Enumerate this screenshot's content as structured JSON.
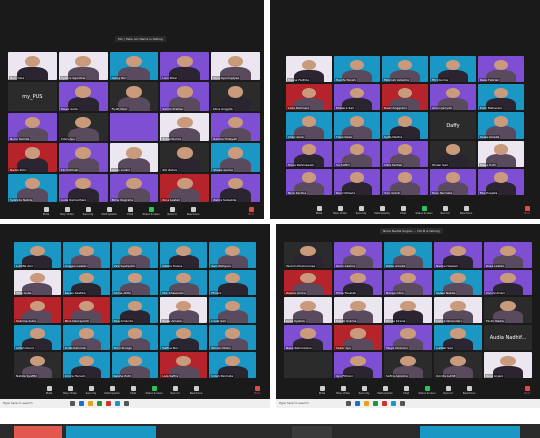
{
  "palette": {
    "panel_bg": "#1a1a1a",
    "tile_purple": "#7f4fd3",
    "tile_cyan": "#1b97c6",
    "tile_red": "#b7232a",
    "tile_dark": "#2b2b2b",
    "tile_white": "#ebe6ef",
    "skin": "#c99a7b",
    "hijab_dark": "#2b2431",
    "end_color": "#e04a4a",
    "share_color": "#2ac45a"
  },
  "toolbar": {
    "mute": "Mute",
    "video": "Stop Video",
    "security": "Security",
    "participants": "Participants",
    "chat": "Chat",
    "share": "Share Screen",
    "record": "Record",
    "reactions": "Reactions",
    "end": "End"
  },
  "taskbar": {
    "search": "Type here to search"
  },
  "screen1": {
    "popup": "Mic | Take out Name is talking",
    "tiles": [
      {
        "name": "Nuri Yulia",
        "bg": "white"
      },
      {
        "name": "Syafira Agustina",
        "bg": "white"
      },
      {
        "name": "Ajeng Nur",
        "bg": "cyan"
      },
      {
        "name": "Lian Rizal",
        "bg": "purple"
      },
      {
        "name": "Alya Ayuningtyas",
        "bg": "white"
      },
      {
        "name": "",
        "bg": "dark",
        "center": "my_PUS"
      },
      {
        "name": "Tasya Aulia",
        "bg": "purple"
      },
      {
        "name": "Fiyah Noor",
        "bg": "dark"
      },
      {
        "name": "Salma Pratiwi",
        "bg": "purple"
      },
      {
        "name": "Dina Anggita",
        "bg": "dark"
      },
      {
        "name": "Nurul Kamila",
        "bg": "purple"
      },
      {
        "name": "Intan Ayu",
        "bg": "dark"
      },
      {
        "name": "",
        "bg": "purple",
        "center": ""
      },
      {
        "name": "Anisa Kurnia",
        "bg": "white"
      },
      {
        "name": "Rahma Hidayah",
        "bg": "purple"
      },
      {
        "name": "Nadia Putri",
        "bg": "red"
      },
      {
        "name": "Siti Fatimah",
        "bg": "purple"
      },
      {
        "name": "Laras Andini",
        "bg": "white"
      },
      {
        "name": "Siti Zahra",
        "bg": "dark"
      },
      {
        "name": "Sheila Aprilia",
        "bg": "cyan"
      },
      {
        "name": "Syahida Nabila",
        "bg": "cyan"
      },
      {
        "name": "Aulia Ramadhani",
        "bg": "purple"
      },
      {
        "name": "Bima Nugraha",
        "bg": "purple"
      },
      {
        "name": "Rina Lestari",
        "bg": "red"
      },
      {
        "name": "Zahra Salsabila",
        "bg": "purple"
      }
    ]
  },
  "screen2": {
    "tiles": [
      {
        "name": "Hasna Fadhila",
        "bg": "white"
      },
      {
        "name": "Hanifa Tanah",
        "bg": "cyan"
      },
      {
        "name": "Fatimah Azzahra",
        "bg": "cyan"
      },
      {
        "name": "Fitri Kurnia",
        "bg": "cyan"
      },
      {
        "name": "Reza Febrian",
        "bg": "purple"
      },
      {
        "name": "Laila Rahmani",
        "bg": "red"
      },
      {
        "name": "Mutiara Sari",
        "bg": "purple"
      },
      {
        "name": "Dewi Anggraini",
        "bg": "red"
      },
      {
        "name": "Ainun Jariyah",
        "bg": "purple"
      },
      {
        "name": "Putri Maharani",
        "bg": "cyan"
      },
      {
        "name": "Jihan Aulia",
        "bg": "cyan"
      },
      {
        "name": "Tiara Dewi",
        "bg": "cyan"
      },
      {
        "name": "Syifa Nadira",
        "bg": "cyan"
      },
      {
        "name": "",
        "bg": "dark",
        "center": "Daffy"
      },
      {
        "name": "Salsa Amalia",
        "bg": "cyan"
      },
      {
        "name": "Hana Rahmawati",
        "bg": "purple"
      },
      {
        "name": "Ira Safitri",
        "bg": "purple"
      },
      {
        "name": "Citra Pertiwi",
        "bg": "purple"
      },
      {
        "name": "Wulan Sari",
        "bg": "dark"
      },
      {
        "name": "Mega Putri",
        "bg": "white"
      },
      {
        "name": "Nina Karlina",
        "bg": "purple"
      },
      {
        "name": "Rani Oktavia",
        "bg": "purple"
      },
      {
        "name": "Yuni Astuti",
        "bg": "purple"
      },
      {
        "name": "Dian Permata",
        "bg": "purple"
      },
      {
        "name": "Eka Puspita",
        "bg": "purple"
      }
    ]
  },
  "screen3": {
    "tiles": [
      {
        "name": "Luthfia Aini",
        "bg": "cyan"
      },
      {
        "name": "Anggun Lestari",
        "bg": "cyan"
      },
      {
        "name": "Vira Syahputri",
        "bg": "cyan"
      },
      {
        "name": "Nabila Husna",
        "bg": "cyan"
      },
      {
        "name": "Sari Wahyuni",
        "bg": "cyan"
      },
      {
        "name": "Yulia Aulia",
        "bg": "white"
      },
      {
        "name": "Kenes Sastika",
        "bg": "cyan"
      },
      {
        "name": "Ghina Alifia",
        "bg": "cyan"
      },
      {
        "name": "Nur Khasanah",
        "bg": "cyan"
      },
      {
        "name": "Fitriani",
        "bg": "cyan"
      },
      {
        "name": "Sabrina Aulia",
        "bg": "red"
      },
      {
        "name": "Mira Damayanti",
        "bg": "red"
      },
      {
        "name": "Dea Amanda",
        "bg": "cyan"
      },
      {
        "name": "Riska Amelia",
        "bg": "white"
      },
      {
        "name": "Linda Sari",
        "bg": "cyan"
      },
      {
        "name": "Alifah Nurul",
        "bg": "cyan"
      },
      {
        "name": "Zulfa Rahmah",
        "bg": "cyan"
      },
      {
        "name": "Tami Sinaga",
        "bg": "cyan"
      },
      {
        "name": "Refina Nur",
        "bg": "cyan"
      },
      {
        "name": "Winda Oktari",
        "bg": "cyan"
      },
      {
        "name": "Nabila Syafitri",
        "bg": "dark"
      },
      {
        "name": "Amira Hanum",
        "bg": "cyan"
      },
      {
        "name": "Keisha Putri",
        "bg": "cyan"
      },
      {
        "name": "Lala Safira",
        "bg": "red"
      },
      {
        "name": "Indah Permata",
        "bg": "cyan"
      }
    ]
  },
  "screen4": {
    "popup": "Nuha Nadila Sugian ... DO B is talking",
    "tiles": [
      {
        "name": "Yasmin Khairunnisa",
        "bg": "dark"
      },
      {
        "name": "Karin Azahra",
        "bg": "purple"
      },
      {
        "name": "Rizka Amalia",
        "bg": "cyan"
      },
      {
        "name": "Nadya Hapsari",
        "bg": "purple"
      },
      {
        "name": "Rosa Lestari",
        "bg": "purple"
      },
      {
        "name": "Zaskia Amira",
        "bg": "red"
      },
      {
        "name": "Hilda Fauziah",
        "bg": "purple"
      },
      {
        "name": "Bunga Citra",
        "bg": "purple"
      },
      {
        "name": "Salwa Nabila",
        "bg": "cyan"
      },
      {
        "name": "Vivi Andriani",
        "bg": "purple"
      },
      {
        "name": "Aura Syakila",
        "bg": "white"
      },
      {
        "name": "Melati Sukma",
        "bg": "white"
      },
      {
        "name": "Dinda Kirana",
        "bg": "white"
      },
      {
        "name": "Cahya Wulandari",
        "bg": "white"
      },
      {
        "name": "Farah Nadia",
        "bg": "dark"
      },
      {
        "name": "Nesa Rahmadani",
        "bg": "purple"
      },
      {
        "name": "Sekar Ayu",
        "bg": "red"
      },
      {
        "name": "Tasya Khairani",
        "bg": "purple"
      },
      {
        "name": "Lutfiah Sari",
        "bg": "cyan"
      },
      {
        "name": "",
        "bg": "dark",
        "center": "Audia Nadhif..."
      },
      {
        "name": "",
        "bg": "dark",
        "center": ""
      },
      {
        "name": "Ayu Fitriani",
        "bg": "purple"
      },
      {
        "name": "Safira Azzahra",
        "bg": "dark"
      },
      {
        "name": "Qonita Luthfi",
        "bg": "dark"
      },
      {
        "name": "Rara Anjani",
        "bg": "white"
      }
    ]
  }
}
